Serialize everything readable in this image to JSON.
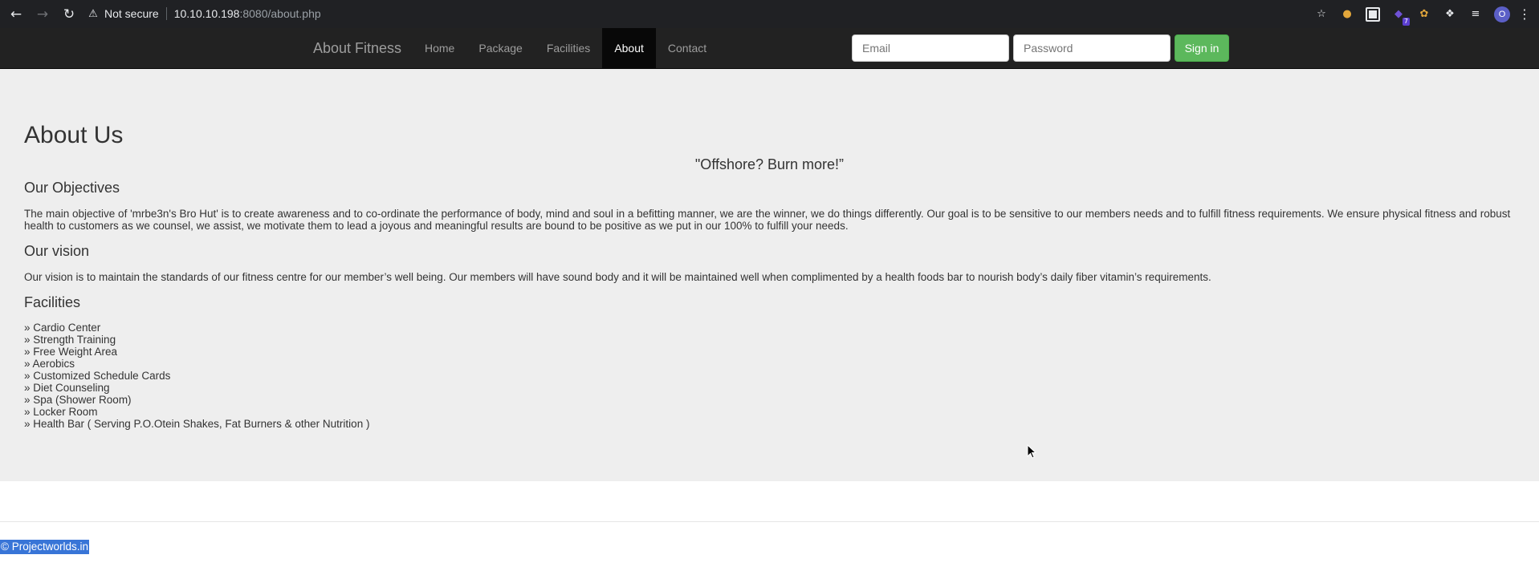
{
  "browser": {
    "back_icon": "arrow-left-icon",
    "forward_icon": "arrow-right-icon",
    "reload_icon": "reload-icon",
    "security_label": "Not secure",
    "url_host": "10.10.10.198",
    "url_rest": ":8080/about.php",
    "extensions": [
      "star-icon",
      "cookie-icon",
      "qr-icon",
      "puzzle-icon",
      "cookie-icon",
      "extensions-icon",
      "media-icon"
    ],
    "extension_badge": "7",
    "profile_initial": "O"
  },
  "navbar": {
    "brand": "About Fitness",
    "links": [
      {
        "label": "Home",
        "active": false
      },
      {
        "label": "Package",
        "active": false
      },
      {
        "label": "Facilities",
        "active": false
      },
      {
        "label": "About",
        "active": true
      },
      {
        "label": "Contact",
        "active": false
      }
    ],
    "email_placeholder": "Email",
    "password_placeholder": "Password",
    "signin_label": "Sign in",
    "signin_color": "#5cb85c"
  },
  "main": {
    "title": "About Us",
    "quote": "\"Offshore? Burn more!”",
    "objectives": {
      "heading": "Our Objectives",
      "text": "The main objective of 'mrbe3n's Bro Hut' is to create awareness and to co-ordinate the performance of body, mind and soul in a befitting manner, we are the winner, we do things differently. Our goal is to be sensitive to our members needs and to fulfill fitness requirements. We ensure physical fitness and robust health to customers as we counsel, we assist, we motivate them to lead a joyous and meaningful results are bound to be positive as we put in our 100% to fulfill your needs."
    },
    "vision": {
      "heading": "Our vision",
      "text": "Our vision is to maintain the standards of our fitness centre for our member’s well being. Our members will have sound body and it will be maintained well when complimented by a health foods bar to nourish body’s daily fiber vitamin’s requirements."
    },
    "facilities": {
      "heading": "Facilities",
      "items": [
        "» Cardio Center",
        "» Strength Training",
        "» Free Weight Area",
        "» Aerobics",
        "» Customized Schedule Cards",
        "» Diet Counseling",
        "» Spa (Shower Room)",
        "» Locker Room",
        "» Health Bar ( Serving P.O.Otein Shakes, Fat Burners & other Nutrition )"
      ]
    }
  },
  "footer": {
    "copyright": "© Projectworlds.in"
  }
}
